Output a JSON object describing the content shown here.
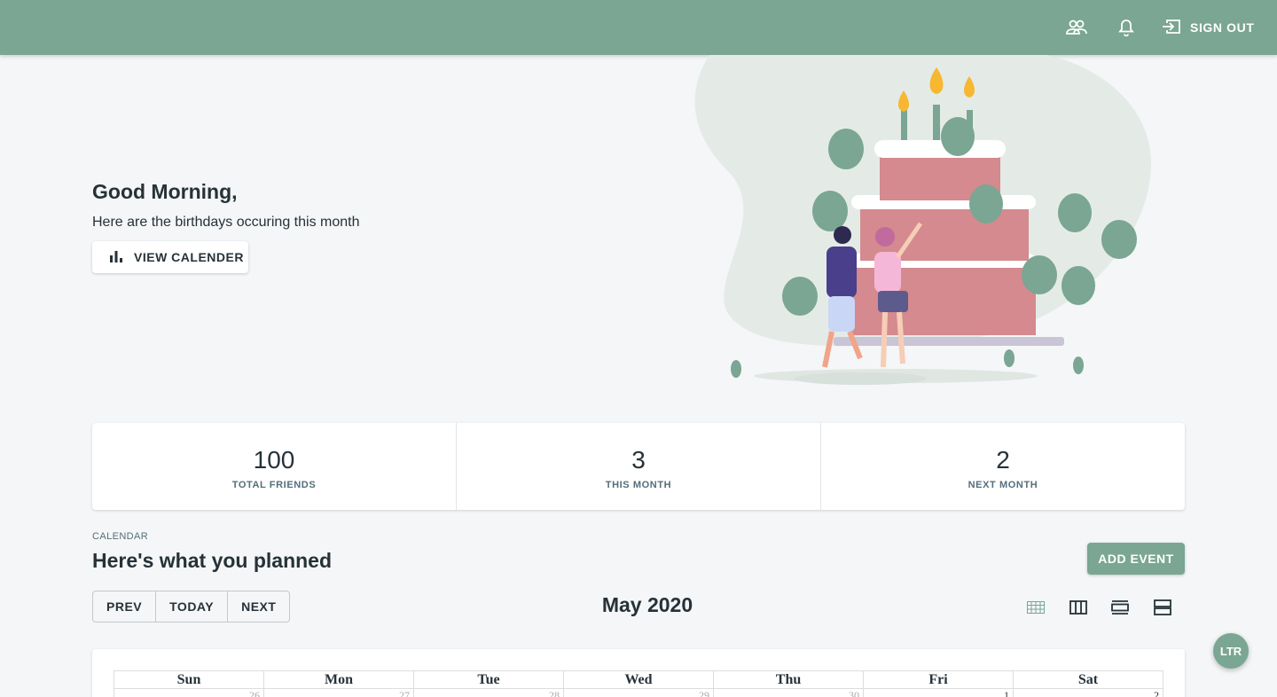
{
  "topbar": {
    "signout_label": "SIGN OUT",
    "icons": [
      "people-icon",
      "bell-icon",
      "signout-icon"
    ]
  },
  "hero": {
    "greeting": "Good Morning,",
    "subtitle": "Here are the birthdays occuring this month",
    "view_calendar_label": "VIEW CALENDER"
  },
  "stats": [
    {
      "value": "100",
      "label": "TOTAL FRIENDS"
    },
    {
      "value": "3",
      "label": "THIS MONTH"
    },
    {
      "value": "2",
      "label": "NEXT MONTH"
    }
  ],
  "calendar": {
    "overline": "CALENDAR",
    "title": "Here's what you planned",
    "add_event_label": "ADD EVENT",
    "nav": {
      "prev": "PREV",
      "today": "TODAY",
      "next": "NEXT"
    },
    "month_label": "May 2020",
    "weekdays": [
      "Sun",
      "Mon",
      "Tue",
      "Wed",
      "Thu",
      "Fri",
      "Sat"
    ],
    "first_row_days": [
      "26",
      "27",
      "28",
      "29",
      "30",
      "1",
      "2"
    ]
  },
  "direction_toggle": "LTR",
  "colors": {
    "primary": "#7aa693",
    "background": "#f4f6f8",
    "text": "#263238"
  }
}
